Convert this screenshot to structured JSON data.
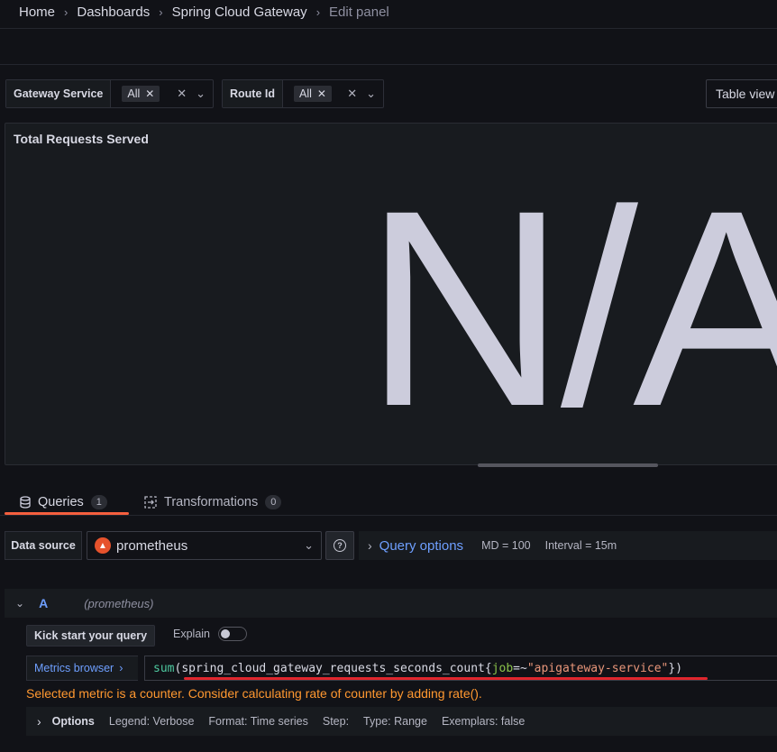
{
  "breadcrumb": {
    "home": "Home",
    "dashboards": "Dashboards",
    "dashboard": "Spring Cloud Gateway",
    "current": "Edit panel"
  },
  "variables": [
    {
      "label": "Gateway Service",
      "value": "All"
    },
    {
      "label": "Route Id",
      "value": "All"
    }
  ],
  "view_toggle": {
    "label": "Table view"
  },
  "panel": {
    "title": "Total Requests Served",
    "value": "N/A"
  },
  "tabs": [
    {
      "label": "Queries",
      "count": "1"
    },
    {
      "label": "Transformations",
      "count": "0"
    }
  ],
  "datasource": {
    "label": "Data source",
    "name": "prometheus",
    "query_options_label": "Query options",
    "md": "MD = 100",
    "interval": "Interval = 15m"
  },
  "query": {
    "ref": "A",
    "datasource": "(prometheus)",
    "kick_start": "Kick start your query",
    "explain": "Explain",
    "metrics_browser": "Metrics browser",
    "expr": {
      "fn": "sum",
      "open": "(",
      "metric": "spring_cloud_gateway_requests_seconds_count",
      "brace_open": "{",
      "label": "job",
      "op": "=~",
      "value": "\"apigateway-service\"",
      "close": "})"
    },
    "warning": "Selected metric is a counter. Consider calculating rate of counter by adding rate().",
    "options": {
      "title": "Options",
      "legend": "Legend: Verbose",
      "format": "Format: Time series",
      "step": "Step:",
      "type": "Type: Range",
      "exemplars": "Exemplars: false"
    }
  },
  "colors": {
    "accent": "#6e9fff",
    "tab_active": "#f55f3e",
    "warning": "#ff9830",
    "error_underline": "#e0262d"
  }
}
